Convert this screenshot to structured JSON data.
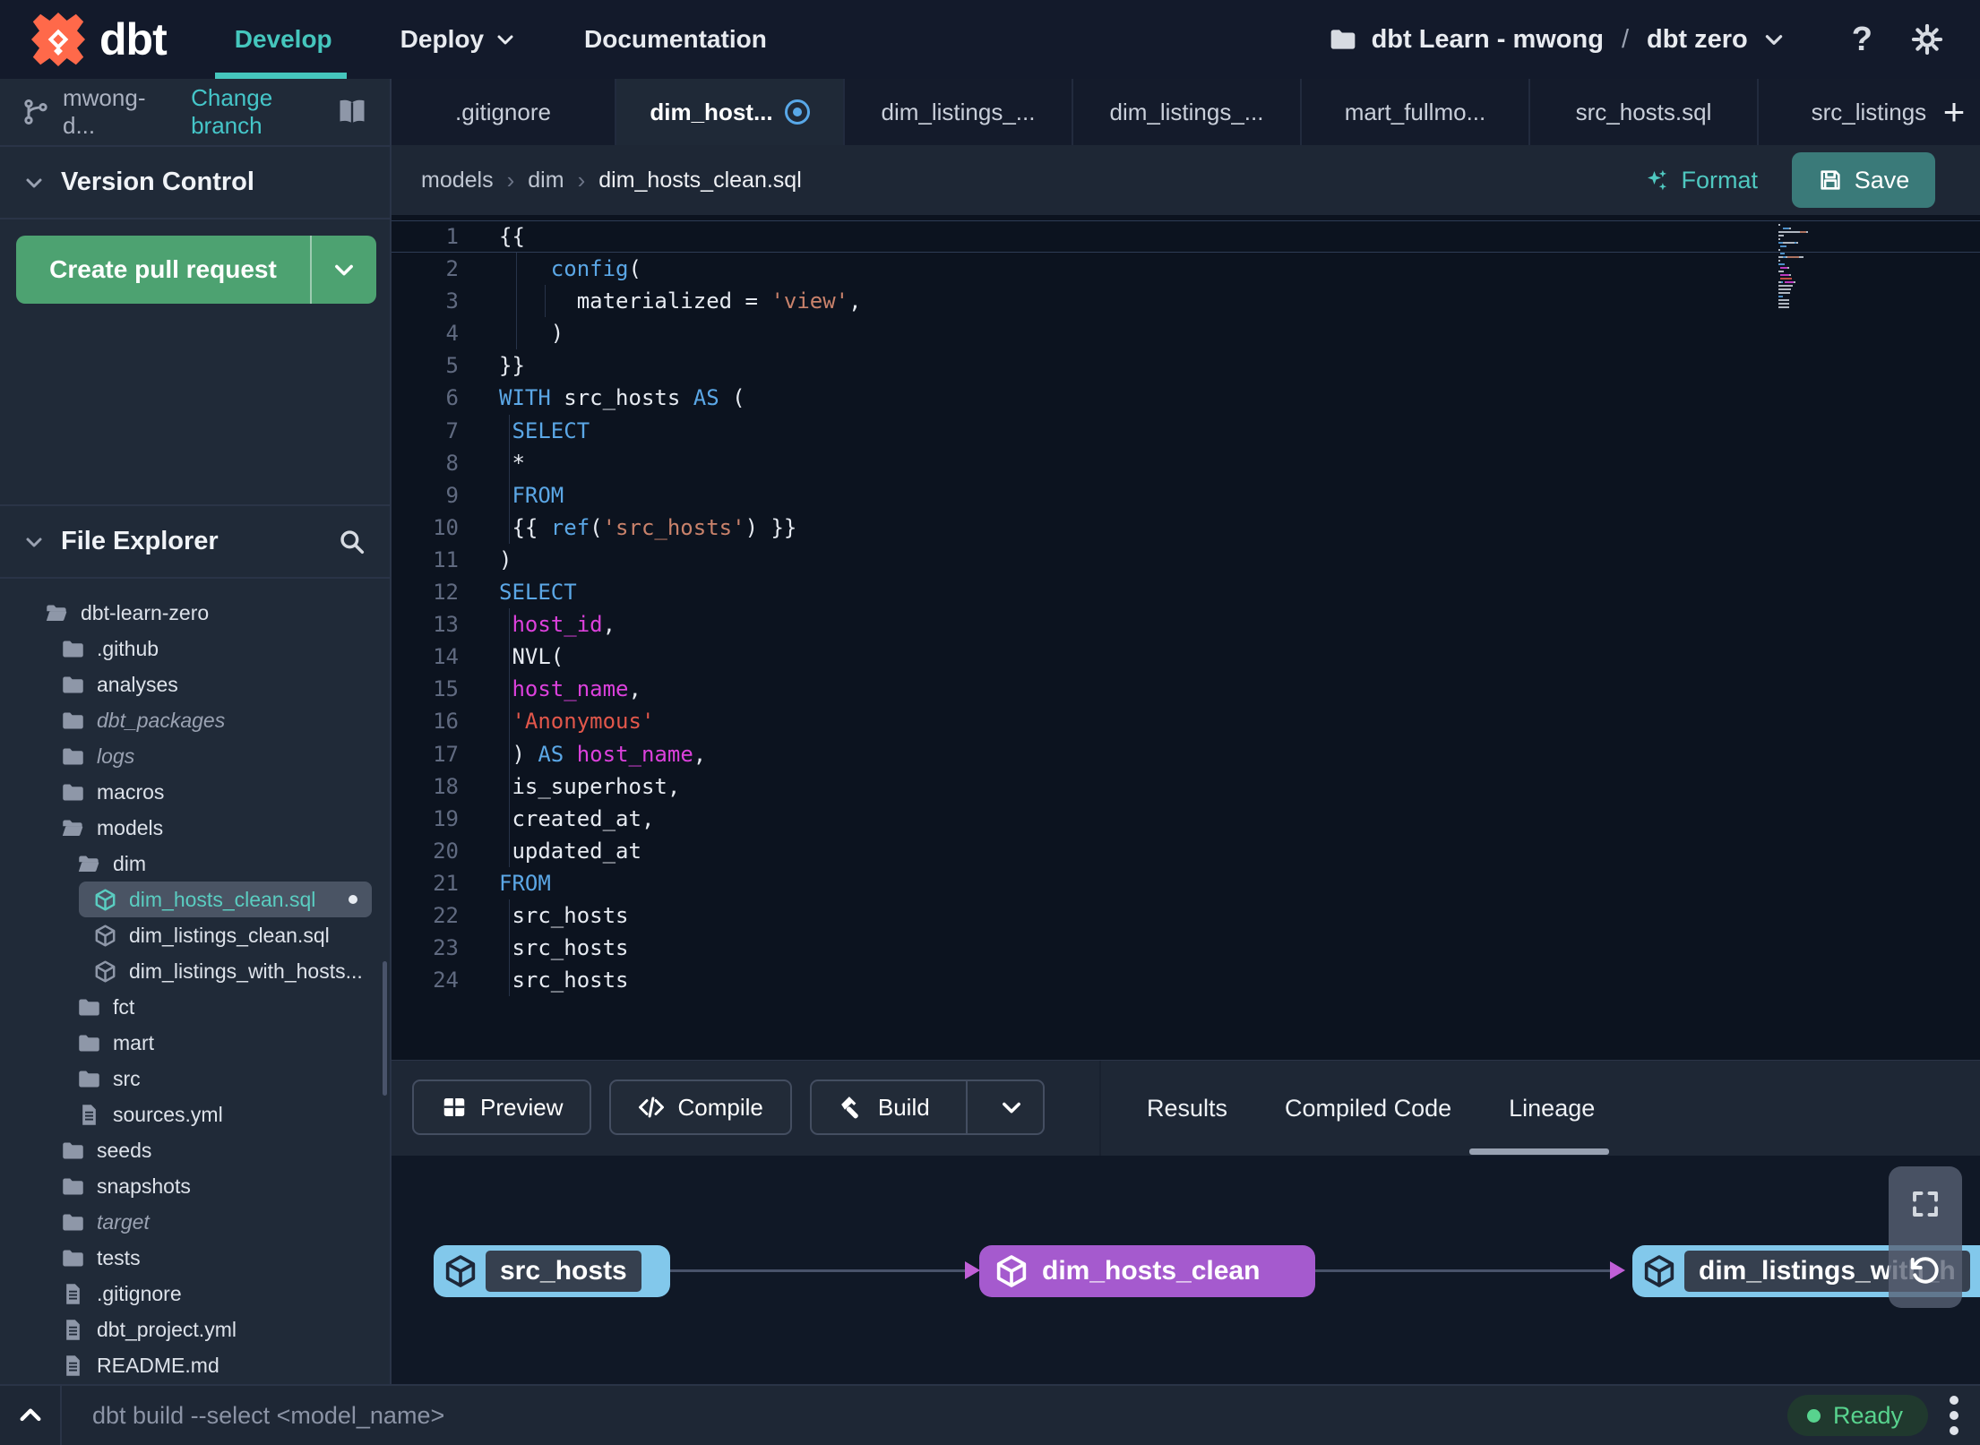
{
  "navbar": {
    "brand": "dbt",
    "items": [
      {
        "label": "Develop",
        "active": true
      },
      {
        "label": "Deploy",
        "has_chevron": true
      },
      {
        "label": "Documentation"
      }
    ],
    "account": "dbt Learn - mwong",
    "separator": "/",
    "project": "dbt zero",
    "help_label": "?"
  },
  "sidebar": {
    "branch": {
      "name": "mwong-d...",
      "action": "Change branch"
    },
    "version_control": {
      "title": "Version Control",
      "button_label": "Create pull request"
    },
    "file_explorer": {
      "title": "File Explorer",
      "tree": [
        {
          "label": "dbt-learn-zero",
          "icon": "folder-open",
          "depth": 0
        },
        {
          "label": ".github",
          "icon": "folder",
          "depth": 1
        },
        {
          "label": "analyses",
          "icon": "folder",
          "depth": 1
        },
        {
          "label": "dbt_packages",
          "icon": "folder",
          "depth": 1,
          "italic": true
        },
        {
          "label": "logs",
          "icon": "folder",
          "depth": 1,
          "italic": true
        },
        {
          "label": "macros",
          "icon": "folder",
          "depth": 1
        },
        {
          "label": "models",
          "icon": "folder-open",
          "depth": 1
        },
        {
          "label": "dim",
          "icon": "folder-open",
          "depth": 2
        },
        {
          "label": "dim_hosts_clean.sql",
          "icon": "model",
          "depth": 3,
          "selected": true,
          "modified": true
        },
        {
          "label": "dim_listings_clean.sql",
          "icon": "model",
          "depth": 3
        },
        {
          "label": "dim_listings_with_hosts...",
          "icon": "model",
          "depth": 3
        },
        {
          "label": "fct",
          "icon": "folder",
          "depth": 2
        },
        {
          "label": "mart",
          "icon": "folder",
          "depth": 2
        },
        {
          "label": "src",
          "icon": "folder",
          "depth": 2
        },
        {
          "label": "sources.yml",
          "icon": "file",
          "depth": 2
        },
        {
          "label": "seeds",
          "icon": "folder",
          "depth": 1
        },
        {
          "label": "snapshots",
          "icon": "folder",
          "depth": 1
        },
        {
          "label": "target",
          "icon": "folder",
          "depth": 1,
          "italic": true
        },
        {
          "label": "tests",
          "icon": "folder",
          "depth": 1
        },
        {
          "label": ".gitignore",
          "icon": "file",
          "depth": 1
        },
        {
          "label": "dbt_project.yml",
          "icon": "file",
          "depth": 1
        },
        {
          "label": "README.md",
          "icon": "file",
          "depth": 1
        }
      ]
    }
  },
  "tabs": {
    "items": [
      {
        "label": ".gitignore"
      },
      {
        "label": "dim_host...",
        "active": true,
        "modified": true
      },
      {
        "label": "dim_listings_..."
      },
      {
        "label": "dim_listings_..."
      },
      {
        "label": "mart_fullmo..."
      },
      {
        "label": "src_hosts.sql"
      },
      {
        "label": "src_listings."
      }
    ],
    "add_label": "+"
  },
  "editor": {
    "breadcrumb": [
      "models",
      "dim",
      "dim_hosts_clean.sql"
    ],
    "format_label": "Format",
    "save_label": "Save",
    "code": {
      "lines": [
        [
          {
            "t": "{{",
            "c": "pl"
          }
        ],
        [
          {
            "t": "    ",
            "c": "pl"
          },
          {
            "t": "config",
            "c": "kw"
          },
          {
            "t": "(",
            "c": "pl"
          }
        ],
        [
          {
            "t": "      materialized = ",
            "c": "pl"
          },
          {
            "t": "'view'",
            "c": "str"
          },
          {
            "t": ",",
            "c": "pl"
          }
        ],
        [
          {
            "t": "    )",
            "c": "pl"
          }
        ],
        [
          {
            "t": "}}",
            "c": "pl"
          }
        ],
        [
          {
            "t": "WITH",
            "c": "kw"
          },
          {
            "t": " src_hosts ",
            "c": "pl"
          },
          {
            "t": "AS",
            "c": "kw"
          },
          {
            "t": " (",
            "c": "pl"
          }
        ],
        [
          {
            "t": " ",
            "c": "pl"
          },
          {
            "t": "SELECT",
            "c": "kw"
          }
        ],
        [
          {
            "t": " *",
            "c": "pl"
          }
        ],
        [
          {
            "t": " ",
            "c": "pl"
          },
          {
            "t": "FROM",
            "c": "kw"
          }
        ],
        [
          {
            "t": " {{ ",
            "c": "pl"
          },
          {
            "t": "ref",
            "c": "kw"
          },
          {
            "t": "(",
            "c": "pl"
          },
          {
            "t": "'src_hosts'",
            "c": "str"
          },
          {
            "t": ") }}",
            "c": "pl"
          }
        ],
        [
          {
            "t": ")",
            "c": "pl"
          }
        ],
        [
          {
            "t": "SELECT",
            "c": "kw"
          }
        ],
        [
          {
            "t": " ",
            "c": "pl"
          },
          {
            "t": "host_id",
            "c": "id"
          },
          {
            "t": ",",
            "c": "pl"
          }
        ],
        [
          {
            "t": " NVL(",
            "c": "pl"
          }
        ],
        [
          {
            "t": " ",
            "c": "pl"
          },
          {
            "t": "host_name",
            "c": "id"
          },
          {
            "t": ",",
            "c": "pl"
          }
        ],
        [
          {
            "t": " ",
            "c": "pl"
          },
          {
            "t": "'Anonymous'",
            "c": "str2"
          }
        ],
        [
          {
            "t": " ) ",
            "c": "pl"
          },
          {
            "t": "AS",
            "c": "kw"
          },
          {
            "t": " ",
            "c": "pl"
          },
          {
            "t": "host_name",
            "c": "id"
          },
          {
            "t": ",",
            "c": "pl"
          }
        ],
        [
          {
            "t": " is_superhost,",
            "c": "pl"
          }
        ],
        [
          {
            "t": " created_at,",
            "c": "pl"
          }
        ],
        [
          {
            "t": " updated_at",
            "c": "pl"
          }
        ],
        [
          {
            "t": "FROM",
            "c": "kw"
          }
        ],
        [
          {
            "t": " src_hosts",
            "c": "pl"
          }
        ],
        [
          {
            "t": " src_hosts",
            "c": "pl"
          }
        ],
        [
          {
            "t": " src_hosts",
            "c": "pl"
          }
        ]
      ],
      "guides": [
        {
          "from": 2,
          "to": 4,
          "x": 16
        },
        {
          "from": 3,
          "to": 3,
          "x": 48
        },
        {
          "from": 7,
          "to": 10,
          "x": 8
        },
        {
          "from": 13,
          "to": 20,
          "x": 8
        },
        {
          "from": 22,
          "to": 24,
          "x": 8
        }
      ],
      "cursor_line": 1
    }
  },
  "bottom_panel": {
    "buttons": [
      {
        "label": "Preview",
        "icon": "grid"
      },
      {
        "label": "Compile",
        "icon": "code"
      },
      {
        "label": "Build",
        "icon": "hammer",
        "split": true
      }
    ],
    "tabs": [
      {
        "label": "Results"
      },
      {
        "label": "Compiled Code"
      },
      {
        "label": "Lineage",
        "active": true
      }
    ],
    "lineage": {
      "nodes": [
        {
          "label": "src_hosts",
          "style": "outlined"
        },
        {
          "label": "dim_hosts_clean",
          "style": "filled"
        },
        {
          "label": "dim_listings_with_h",
          "style": "outlined"
        }
      ]
    }
  },
  "status_bar": {
    "command_placeholder": "dbt build --select <model_name>",
    "status_label": "Ready"
  },
  "accents": {
    "teal": "#45c6bd",
    "green_button": "#4da271",
    "save_button": "#3a7a79",
    "ready_green": "#58d38e",
    "node_blue": "#82c8eb",
    "node_purple": "#a55ace",
    "modified_blue": "#58a8e8",
    "code_keyword": "#5ba7e6",
    "code_string": "#c9826b",
    "code_string_alt": "#e2574b",
    "code_identifier": "#dc41dc"
  }
}
